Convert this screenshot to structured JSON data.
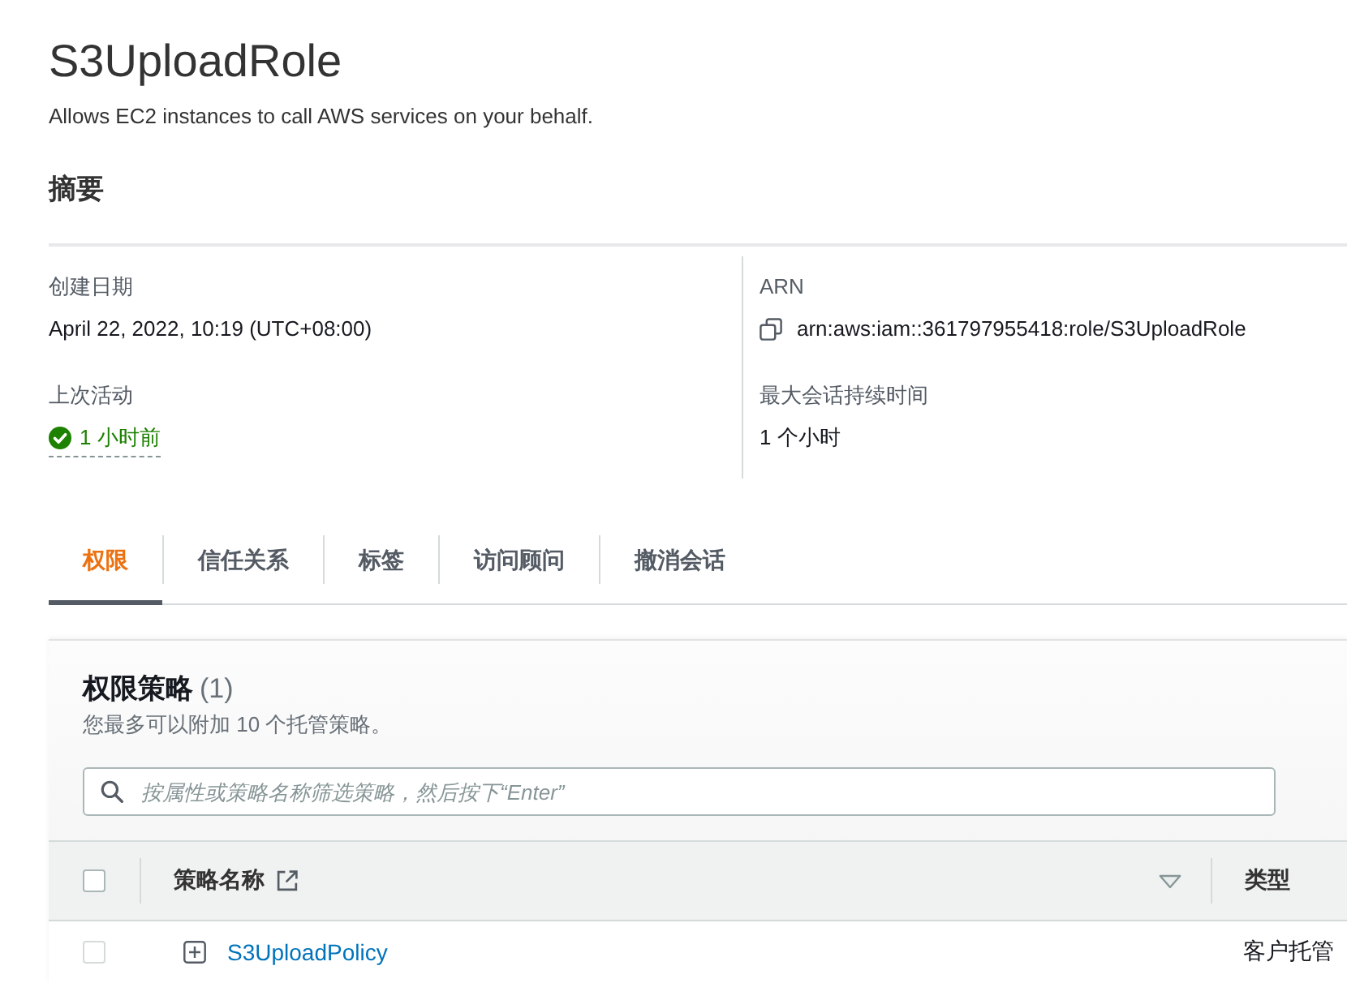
{
  "role": {
    "title": "S3UploadRole",
    "description": "Allows EC2 instances to call AWS services on your behalf."
  },
  "summary": {
    "heading": "摘要",
    "columns": [
      {
        "fields": [
          {
            "kind": "text",
            "label": "创建日期",
            "value": "April 22, 2022, 10:19 (UTC+08:00)"
          },
          {
            "kind": "status",
            "label": "上次活动",
            "value": "1 小时前"
          }
        ]
      },
      {
        "fields": [
          {
            "kind": "copy",
            "label": "ARN",
            "value": "arn:aws:iam::361797955418:role/S3UploadRole"
          },
          {
            "kind": "text",
            "label": "最大会话持续时间",
            "value": "1 个小时"
          }
        ]
      }
    ]
  },
  "tabs": [
    {
      "label": "权限",
      "selected": true
    },
    {
      "label": "信任关系",
      "selected": false
    },
    {
      "label": "标签",
      "selected": false
    },
    {
      "label": "访问顾问",
      "selected": false
    },
    {
      "label": "撤消会话",
      "selected": false
    }
  ],
  "permissions": {
    "heading": "权限策略",
    "count": "(1)",
    "note": "您最多可以附加 10 个托管策略。",
    "search": {
      "placeholder": "按属性或策略名称筛选策略，然后按下“Enter”"
    },
    "table": {
      "select_all": {
        "checked": false
      },
      "columns": [
        {
          "label": "策略名称",
          "kind": "external",
          "sorted": true
        },
        {
          "label": "类型",
          "kind": "plain",
          "sorted": false
        }
      ],
      "rows": [
        {
          "selected": false,
          "expanded": false,
          "name": "S3UploadPolicy",
          "type": "客户托管"
        }
      ]
    }
  }
}
